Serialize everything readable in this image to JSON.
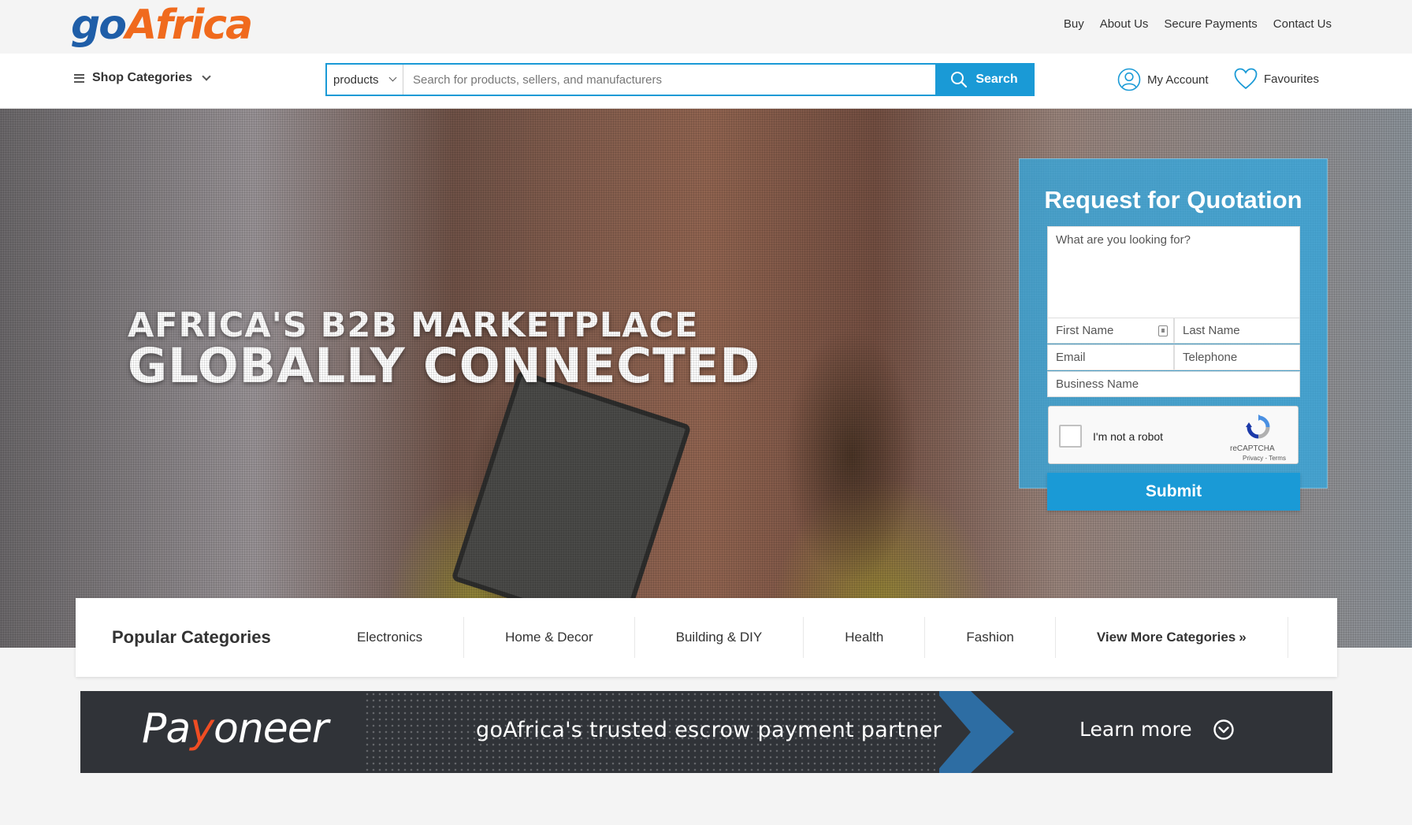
{
  "brand": {
    "logo_go": "go",
    "logo_africa": "Africa",
    "go_color": "#1f5ea8",
    "africa_color": "#f06a1d"
  },
  "top_links": [
    "Buy",
    "About Us",
    "Secure Payments",
    "Contact Us"
  ],
  "nav": {
    "shop_categories": "Shop Categories",
    "search_scope": "products",
    "search_placeholder": "Search for products, sellers, and manufacturers",
    "search_button": "Search",
    "my_account": "My Account",
    "favourites": "Favourites",
    "accent_color": "#1a9ad6"
  },
  "hero": {
    "headline_line1": "AFRICA'S B2B MARKETPLACE",
    "headline_line2": "GLOBALLY CONNECTED"
  },
  "rfq": {
    "title": "Request for Quotation",
    "looking_for_placeholder": "What are you looking for?",
    "first_name_placeholder": "First Name",
    "last_name_placeholder": "Last Name",
    "email_placeholder": "Email",
    "telephone_placeholder": "Telephone",
    "business_name_placeholder": "Business Name",
    "captcha_label": "I'm not a robot",
    "captcha_brand": "reCAPTCHA",
    "captcha_terms": "Privacy - Terms",
    "submit_label": "Submit"
  },
  "popular": {
    "title": "Popular Categories",
    "categories": [
      "Electronics",
      "Home & Decor",
      "Building & DIY",
      "Health",
      "Fashion"
    ],
    "view_more": "View More Categories",
    "view_more_glyph": "»"
  },
  "banner": {
    "logo_pa": "Pa",
    "logo_y": "y",
    "logo_rest": "oneer",
    "tagline": "goAfrica's trusted escrow payment partner",
    "cta": "Learn more",
    "logo_accent": "#f04d23"
  }
}
